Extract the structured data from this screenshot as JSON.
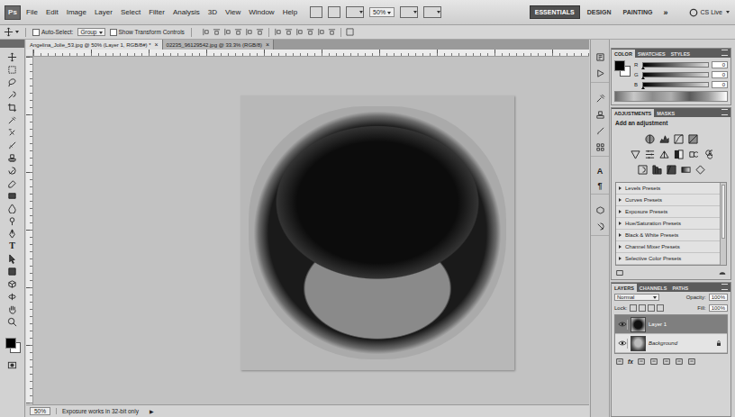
{
  "app": {
    "logo": "Ps"
  },
  "menu": [
    "File",
    "Edit",
    "Image",
    "Layer",
    "Select",
    "Filter",
    "Analysis",
    "3D",
    "View",
    "Window",
    "Help"
  ],
  "zoom": "50%",
  "workspaces": [
    {
      "label": "ESSENTIALS",
      "selected": true
    },
    {
      "label": "DESIGN",
      "selected": false
    },
    {
      "label": "PAINTING",
      "selected": false
    }
  ],
  "more": "»",
  "cs_live": "CS Live",
  "options_bar": {
    "auto_select": {
      "label": "Auto-Select:",
      "checked": false
    },
    "auto_select_value": "Group",
    "transform": {
      "label": "Show Transform Controls",
      "checked": false
    }
  },
  "documents": [
    {
      "title": "Angelina_Jolie_53.jpg @ 50% (Layer 1, RGB/8#) *",
      "selected": true,
      "close": "×"
    },
    {
      "title": "02235_96129542.jpg @ 33.3% (RGB/8)",
      "selected": false,
      "close": "×"
    }
  ],
  "toolbar": {
    "type_glyph": "T"
  },
  "dock": {
    "character": "A",
    "paragraph": "¶"
  },
  "color_panel": {
    "tabs": [
      {
        "label": "COLOR",
        "selected": true
      },
      {
        "label": "SWATCHES",
        "selected": false
      },
      {
        "label": "STYLES",
        "selected": false
      }
    ],
    "channels": [
      {
        "name": "R",
        "value": "0",
        "level": 0
      },
      {
        "name": "G",
        "value": "0",
        "level": 0
      },
      {
        "name": "B",
        "value": "0",
        "level": 0
      }
    ]
  },
  "adjustments_panel": {
    "tabs": [
      {
        "label": "ADJUSTMENTS",
        "selected": true
      },
      {
        "label": "MASKS",
        "selected": false
      }
    ],
    "heading": "Add an adjustment",
    "presets": [
      {
        "label": "Levels Presets",
        "expanded": false
      },
      {
        "label": "Curves Presets",
        "expanded": false
      },
      {
        "label": "Exposure Presets",
        "expanded": false
      },
      {
        "label": "Hue/Saturation Presets",
        "expanded": false
      },
      {
        "label": "Black & White Presets",
        "expanded": false
      },
      {
        "label": "Channel Mixer Presets",
        "expanded": false
      },
      {
        "label": "Selective Color Presets",
        "expanded": false
      }
    ]
  },
  "layers_panel": {
    "tabs": [
      {
        "label": "LAYERS",
        "selected": true
      },
      {
        "label": "CHANNELS",
        "selected": false
      },
      {
        "label": "PATHS",
        "selected": false
      }
    ],
    "blend_mode": "Normal",
    "opacity_label": "Opacity:",
    "opacity": "100%",
    "lock_label": "Lock:",
    "fill_label": "Fill:",
    "fill": "100%",
    "layers": [
      {
        "name": "Layer 1",
        "selected": true,
        "visible": true,
        "locked": false
      },
      {
        "name": "Background",
        "selected": false,
        "visible": true,
        "locked": true
      }
    ],
    "fx": "fx"
  },
  "status_bar": {
    "zoom": "50%",
    "info": "Exposure works in 32-bit only",
    "arrow": "▶"
  }
}
